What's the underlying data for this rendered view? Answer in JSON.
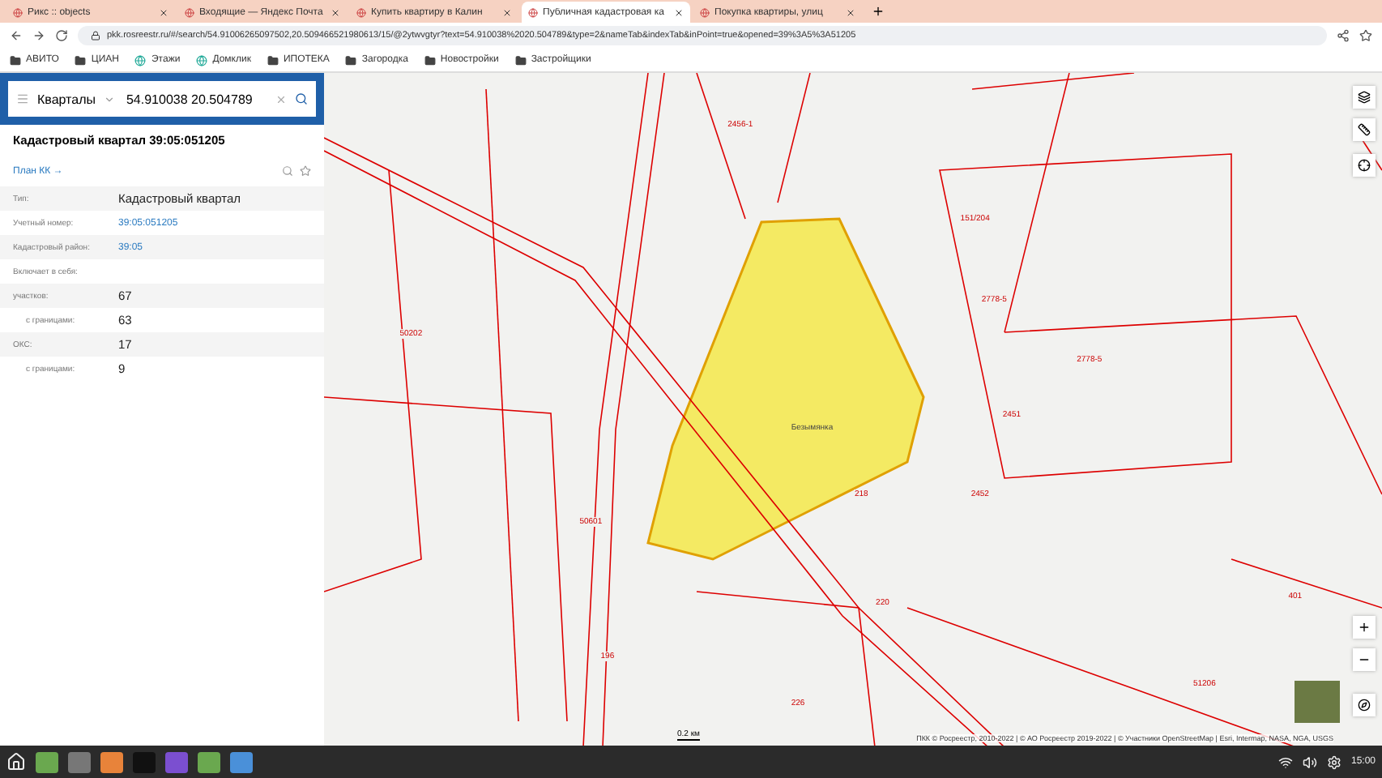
{
  "browser": {
    "tabs": [
      {
        "title": "Рикс :: objects",
        "selected": false
      },
      {
        "title": "Входящие — Яндекс Почта",
        "selected": false
      },
      {
        "title": "Купить квартиру в Калин",
        "selected": false
      },
      {
        "title": "Публичная кадастровая ка",
        "selected": true
      },
      {
        "title": "Покупка квартиры, улиц",
        "selected": false
      }
    ],
    "url": "pkk.rosreestr.ru/#/search/54.91006265097502,20.509466521980613/15/@2ytwvgtyr?text=54.910038%2020.504789&type=2&nameTab&indexTab&inPoint=true&opened=39%3A5%3A51205",
    "bookmarks": [
      {
        "kind": "folder",
        "label": "АВИТО"
      },
      {
        "kind": "folder",
        "label": "ЦИАН"
      },
      {
        "kind": "site",
        "label": "Этажи"
      },
      {
        "kind": "site",
        "label": "Домклик"
      },
      {
        "kind": "folder",
        "label": "ИПОТЕКА"
      },
      {
        "kind": "folder",
        "label": "Загородка"
      },
      {
        "kind": "folder",
        "label": "Новостройки"
      },
      {
        "kind": "folder",
        "label": "Застройщики"
      }
    ]
  },
  "panel": {
    "search": {
      "layer": "Кварталы",
      "value": "54.910038 20.504789"
    },
    "title": "Кадастровый квартал 39:05:051205",
    "plan_link": "План КК →",
    "rows": [
      {
        "label": "Тип:",
        "value": "Кадастровый квартал",
        "kind": "text",
        "indent": false
      },
      {
        "label": "Учетный номер:",
        "value": "39:05:051205",
        "kind": "link",
        "indent": false
      },
      {
        "label": "Кадастровый район:",
        "value": "39:05",
        "kind": "link",
        "indent": false
      },
      {
        "label": "Включает в себя:",
        "kind": "text",
        "indent": false
      },
      {
        "label": "участков:",
        "value": "67",
        "kind": "text",
        "indent": false
      },
      {
        "label": "с границами:",
        "value": "63",
        "kind": "text",
        "indent": true
      },
      {
        "label": "ОКС:",
        "value": "17",
        "kind": "text",
        "indent": false
      },
      {
        "label": "с границами:",
        "value": "9",
        "kind": "text",
        "indent": true
      }
    ]
  },
  "map": {
    "labels": [
      "Безымянка",
      "50601",
      "50202",
      "2778-5",
      "2778-5",
      "151/204",
      "2451",
      "2452",
      "218",
      "220",
      "401",
      "196",
      "226",
      "2456-1",
      "51206"
    ],
    "scale": "0.2 км",
    "attribution": "ПКК © Росреестр, 2010-2022 | © АО Росреестр 2019-2022 | © Участники OpenStreetMap | Esri, Intermap, NASA, NGA, USGS"
  },
  "taskbar": {
    "time": "15:00"
  }
}
